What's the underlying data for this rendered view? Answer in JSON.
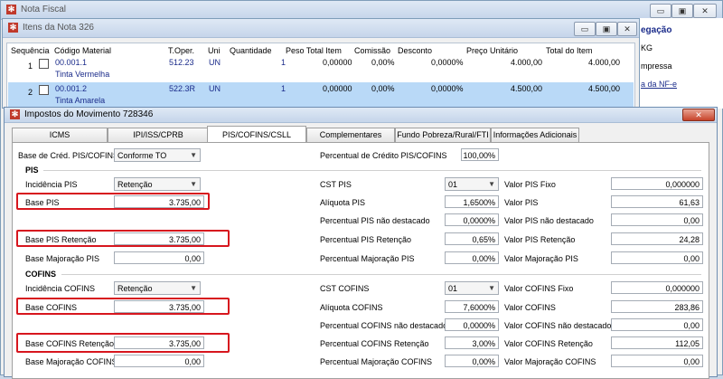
{
  "outer_window": {
    "title": "Nota Fiscal"
  },
  "items_window": {
    "title": "Itens da Nota 326",
    "columns": [
      "Sequência",
      "Código Material",
      "T.Oper.",
      "Uni",
      "Quantidade",
      "Peso Total Item",
      "Comissão",
      "Desconto",
      "Preço Unitário",
      "Total do Item"
    ],
    "rows": [
      {
        "seq": "1",
        "code": "00.001.1",
        "desc": "Tinta Vermelha",
        "toper": "512.23",
        "uni": "UN",
        "qtd": "1",
        "peso": "0,00000",
        "comissao": "0,00%",
        "desconto": "0,0000%",
        "preco": "4.000,00",
        "total": "4.000,00"
      },
      {
        "seq": "2",
        "code": "00.001.2",
        "desc": "Tinta Amarela",
        "toper": "522.3R",
        "uni": "UN",
        "qtd": "1",
        "peso": "0,00000",
        "comissao": "0,00%",
        "desconto": "0,0000%",
        "preco": "4.500,00",
        "total": "4.500,00"
      }
    ]
  },
  "right_panel": {
    "lines": [
      "egação",
      "KG",
      "mpressa",
      "a da NF-e"
    ]
  },
  "dialog": {
    "title": "Impostos do Movimento 728346",
    "tabs": [
      "ICMS",
      "IPI/ISS/CPRB",
      "PIS/COFINS/CSLL",
      "Complementares",
      "Fundo Pobreza/Rural/FTI",
      "Informações Adicionais"
    ],
    "active_tab": "PIS/COFINS/CSLL",
    "base_cred_label": "Base de Créd. PIS/COFINS",
    "base_cred_value": "Conforme TO",
    "perc_cred_label": "Percentual de Crédito PIS/COFINS",
    "perc_cred_value": "100,00%",
    "pis": {
      "header": "PIS",
      "incidencia_label": "Incidência PIS",
      "incidencia_value": "Retenção",
      "cst_label": "CST PIS",
      "cst_value": "01",
      "valor_fixo_label": "Valor PIS Fixo",
      "valor_fixo_value": "0,000000",
      "base_label": "Base PIS",
      "base_value": "3.735,00",
      "aliquota_label": "Alíquota PIS",
      "aliquota_value": "1,6500%",
      "valor_label": "Valor PIS",
      "valor_value": "61,63",
      "perc_nd_label": "Percentual PIS não destacado",
      "perc_nd_value": "0,0000%",
      "valor_nd_label": "Valor PIS não destacado",
      "valor_nd_value": "0,00",
      "base_ret_label": "Base PIS Retenção",
      "base_ret_value": "3.735,00",
      "perc_ret_label": "Percentual PIS Retenção",
      "perc_ret_value": "0,65%",
      "valor_ret_label": "Valor PIS Retenção",
      "valor_ret_value": "24,28",
      "base_maj_label": "Base Majoração PIS",
      "base_maj_value": "0,00",
      "perc_maj_label": "Percentual Majoração PIS",
      "perc_maj_value": "0,00%",
      "valor_maj_label": "Valor Majoração PIS",
      "valor_maj_value": "0,00"
    },
    "cofins": {
      "header": "COFINS",
      "incidencia_label": "Incidência COFINS",
      "incidencia_value": "Retenção",
      "cst_label": "CST COFINS",
      "cst_value": "01",
      "valor_fixo_label": "Valor COFINS Fixo",
      "valor_fixo_value": "0,000000",
      "base_label": "Base COFINS",
      "base_value": "3.735,00",
      "aliquota_label": "Alíquota COFINS",
      "aliquota_value": "7,6000%",
      "valor_label": "Valor COFINS",
      "valor_value": "283,86",
      "perc_nd_label": "Percentual COFINS não destacado",
      "perc_nd_value": "0,0000%",
      "valor_nd_label": "Valor COFINS não destacado",
      "valor_nd_value": "0,00",
      "base_ret_label": "Base COFINS Retenção",
      "base_ret_value": "3.735,00",
      "perc_ret_label": "Percentual COFINS Retenção",
      "perc_ret_value": "3,00%",
      "valor_ret_label": "Valor COFINS Retenção",
      "valor_ret_value": "112,05",
      "base_maj_label": "Base Majoração COFINS",
      "base_maj_value": "0,00",
      "perc_maj_label": "Percentual Majoração COFINS",
      "perc_maj_value": "0,00%",
      "valor_maj_label": "Valor Majoração COFINS",
      "valor_maj_value": "0,00"
    }
  },
  "colors": {
    "highlight": "#d7161e",
    "selected_row": "#b9d9f7",
    "link": "#1a2b8a"
  }
}
